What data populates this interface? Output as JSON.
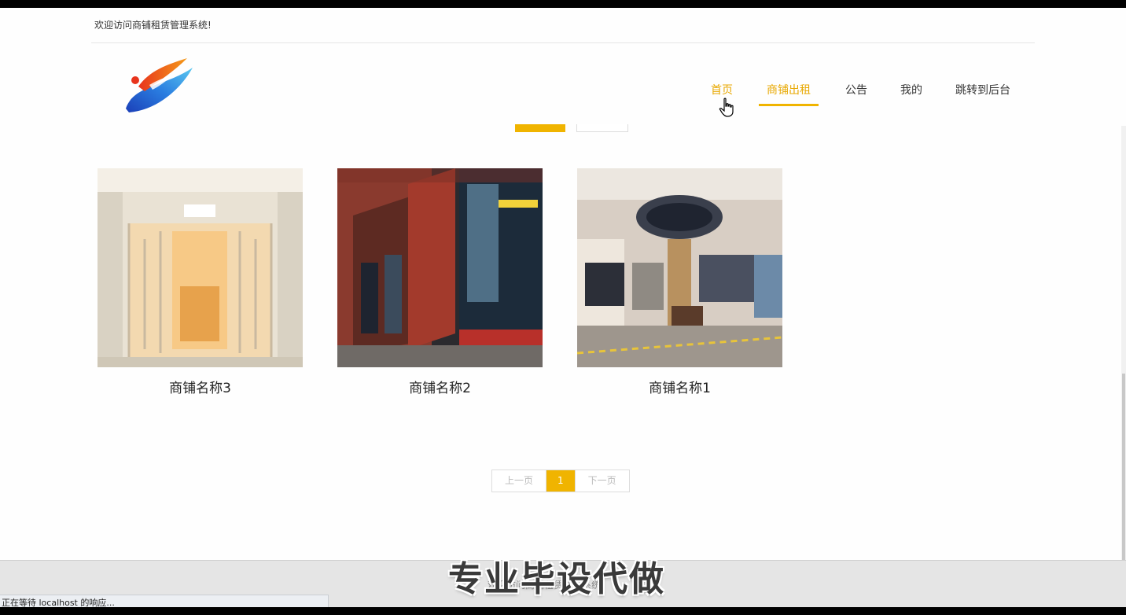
{
  "header": {
    "welcome": "欢迎访问商铺租赁管理系统!"
  },
  "nav": {
    "items": [
      {
        "label": "首页"
      },
      {
        "label": "商铺出租"
      },
      {
        "label": "公告"
      },
      {
        "label": "我的"
      },
      {
        "label": "跳转到后台"
      }
    ],
    "active_underline": "商铺出租"
  },
  "shops": [
    {
      "name": "商铺名称3"
    },
    {
      "name": "商铺名称2"
    },
    {
      "name": "商铺名称1"
    }
  ],
  "pagination": {
    "prev": "上一页",
    "current": "1",
    "next": "下一页"
  },
  "footer": {
    "text": "欢迎访问商铺租赁管理系统!"
  },
  "watermark": "专业毕设代做",
  "status_bar": "正在等待 localhost 的响应...",
  "colors": {
    "accent": "#f0b400",
    "accent_text": "#e8a800"
  }
}
